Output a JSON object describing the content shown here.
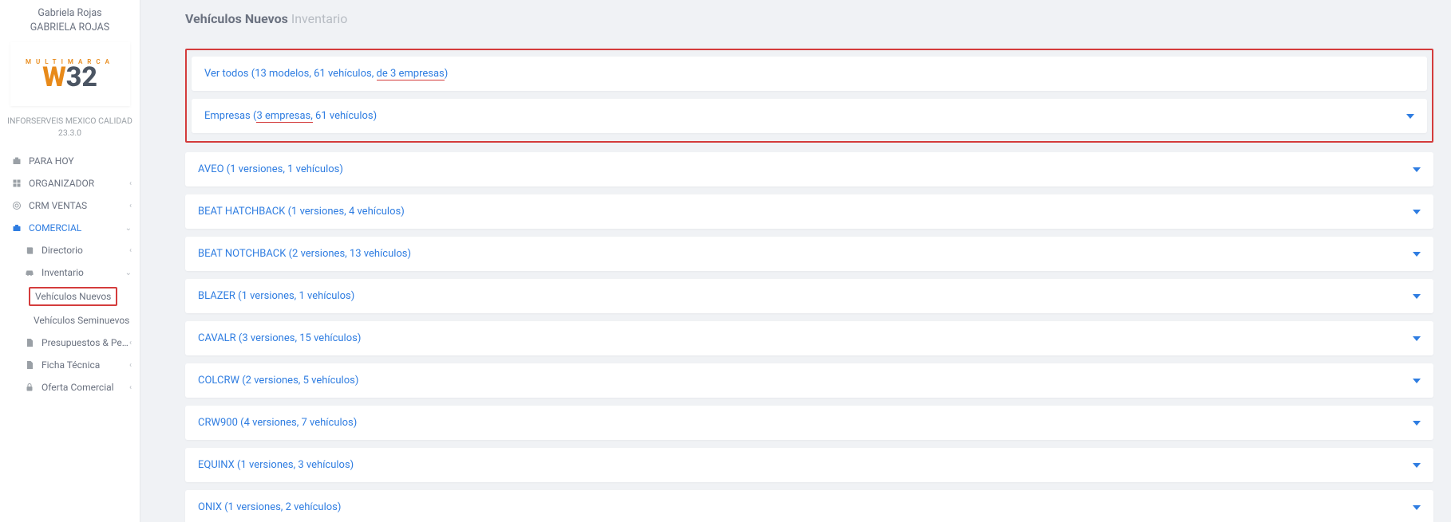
{
  "user": {
    "name": "Gabriela Rojas",
    "alias": "GABRIELA ROJAS"
  },
  "brand": {
    "tag": "MULTIMARCA",
    "letter": "W",
    "num": "32"
  },
  "company": {
    "name": "INFORSERVEIS MEXICO CALIDAD",
    "version": "23.3.0"
  },
  "nav": {
    "para_hoy": "PARA HOY",
    "organizador": "ORGANIZADOR",
    "crm": "CRM VENTAS",
    "comercial": "COMERCIAL",
    "directorio": "Directorio",
    "inventario": "Inventario",
    "veh_nuevos": "Vehículos Nuevos",
    "veh_semi": "Vehículos Seminuevos",
    "presupuestos": "Presupuestos & Pedidos",
    "ficha": "Ficha Técnica",
    "oferta": "Oferta Comercial"
  },
  "page": {
    "title": "Vehículos Nuevos",
    "subtitle": "Inventario"
  },
  "top_panels": {
    "ver_todos_pre": "Ver todos (13 modelos, 61 vehículos, ",
    "ver_todos_ul": "de 3 empresas",
    "ver_todos_post": ")",
    "empresas_pre": "Empresas (",
    "empresas_ul": "3 empresas,",
    "empresas_post": " 61 vehículos)"
  },
  "models": [
    {
      "label": "AVEO (1 versiones, 1 vehículos)"
    },
    {
      "label": "BEAT HATCHBACK (1 versiones, 4 vehículos)"
    },
    {
      "label": "BEAT NOTCHBACK (2 versiones, 13 vehículos)"
    },
    {
      "label": "BLAZER (1 versiones, 1 vehículos)"
    },
    {
      "label": "CAVALR (3 versiones, 15 vehículos)"
    },
    {
      "label": "COLCRW (2 versiones, 5 vehículos)"
    },
    {
      "label": "CRW900 (4 versiones, 7 vehículos)"
    },
    {
      "label": "EQUINX (1 versiones, 3 vehículos)"
    },
    {
      "label": "ONIX (1 versiones, 2 vehículos)"
    }
  ]
}
